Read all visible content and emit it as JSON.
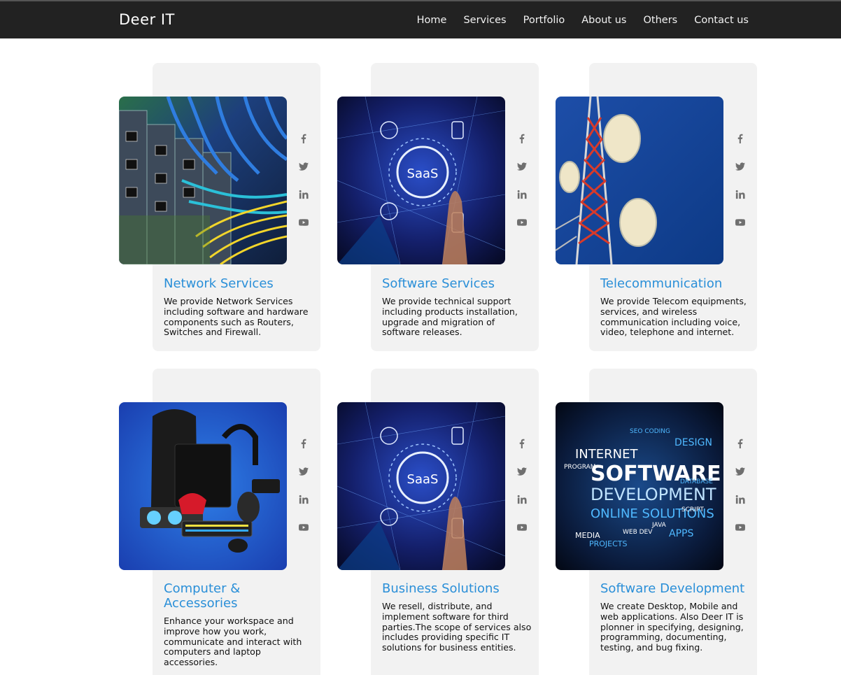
{
  "header": {
    "brand": "Deer IT",
    "nav": [
      "Home",
      "Services",
      "Portfolio",
      "About us",
      "Others",
      "Contact us"
    ]
  },
  "social_icons": [
    "facebook-icon",
    "twitter-icon",
    "linkedin-icon",
    "youtube-icon"
  ],
  "colors": {
    "navbar": "#222222",
    "card": "#f2f2f2",
    "title": "#2a8fd8"
  },
  "cards": [
    {
      "title": "Network Services",
      "desc": "We provide Network Services including software and hardware components such as Routers, Switches and Firewall."
    },
    {
      "title": "Software Services",
      "desc": "We provide technical support including products installation, upgrade and migration of software releases."
    },
    {
      "title": "Telecommunication",
      "desc": "We provide Telecom equipments, services, and wireless communication including voice, video, telephone and internet."
    },
    {
      "title": "Computer & Accessories",
      "desc": "Enhance your workspace and improve how you work, communicate and interact with computers and laptop accessories."
    },
    {
      "title": "Business Solutions",
      "desc": "We resell, distribute, and implement software for third parties.The scope of services also includes providing specific IT solutions for business entities."
    },
    {
      "title": "Software Development",
      "desc": "We create Desktop, Mobile and web applications. Also Deer IT is plonner in specifying, designing, programming, documenting, testing, and bug fixing."
    }
  ],
  "images": {
    "saas_label": "SaaS",
    "cloud_words": [
      "SOFTWARE",
      "DEVELOPMENT",
      "INTERNET",
      "ONLINE SOLUTIONS",
      "DESIGN",
      "APPS",
      "PROGRAM",
      "MEDIA",
      "PROJECTS",
      "WEB DEV",
      "JAVA",
      "DATABASE",
      "SCRIPT",
      "SEO CODING"
    ]
  }
}
